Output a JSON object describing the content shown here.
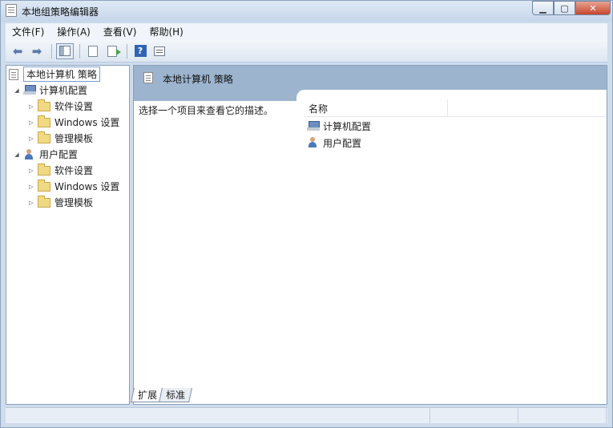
{
  "window": {
    "title": "本地组策略编辑器"
  },
  "menubar": {
    "items": [
      {
        "label": "文件(F)"
      },
      {
        "label": "操作(A)"
      },
      {
        "label": "查看(V)"
      },
      {
        "label": "帮助(H)"
      }
    ]
  },
  "tree": {
    "root": "本地计算机 策略",
    "computer_config": "计算机配置",
    "user_config": "用户配置",
    "children": [
      "软件设置",
      "Windows 设置",
      "管理模板"
    ]
  },
  "content": {
    "header_title": "本地计算机 策略",
    "description": "选择一个项目来查看它的描述。",
    "column_name": "名称",
    "items": [
      "计算机配置",
      "用户配置"
    ]
  },
  "tabs": [
    {
      "label": "扩展"
    },
    {
      "label": "标准"
    }
  ]
}
